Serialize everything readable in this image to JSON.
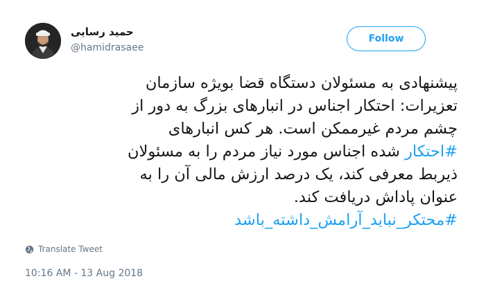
{
  "user": {
    "display_name": "حمید رسایی",
    "handle": "@hamidrasaee"
  },
  "follow_label": "Follow",
  "tweet": {
    "line1": "پیشنهادی به مسئولان دستگاه قضا بویژه سازمان",
    "line2": "تعزیرات: احتکار اجناس در انبارهای بزرگ به دور از",
    "line3": "چشم مردم غیرممکن است. هر کس انبارهای",
    "hashtag1": "#احتکار",
    "line4_rest": " شده اجناس مورد نیاز مردم را به مسئولان",
    "line5": "ذیربط معرفی کند، یک درصد ارزش مالی آن را به",
    "line6": "عنوان پاداش دریافت کند.",
    "hashtag2": "#محتکر_نباید_آرامش_داشته_باشد"
  },
  "translate_label": "Translate Tweet",
  "timestamp": "10:16 AM - 13 Aug 2018",
  "colors": {
    "accent": "#1da1f2",
    "text": "#14171a",
    "muted": "#657786"
  }
}
